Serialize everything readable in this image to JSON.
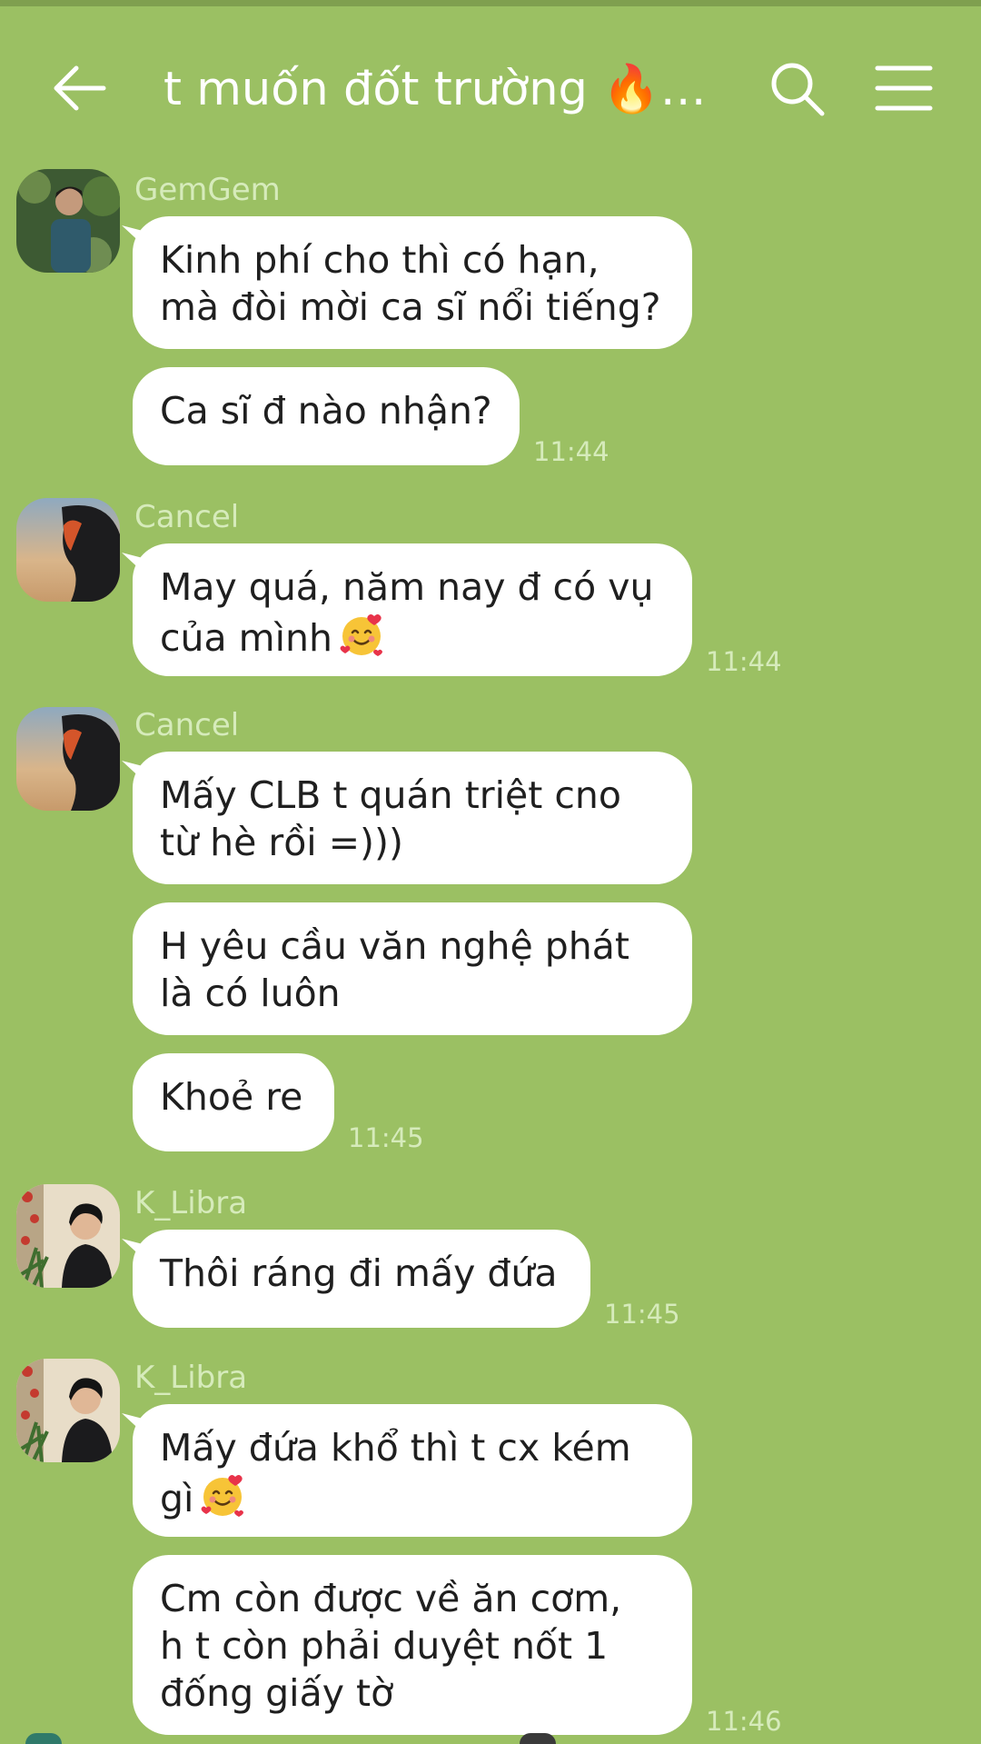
{
  "header": {
    "title": "t muốn đốt trường 🔥…"
  },
  "messages": {
    "m1": {
      "sender": "GemGem",
      "text": "Kinh phí cho thì có hạn,\nmà đòi mời ca sĩ nổi tiếng?"
    },
    "m2": {
      "text": "Ca sĩ đ nào nhận?",
      "time": "11:44"
    },
    "m3": {
      "sender": "Cancel",
      "text": "May quá, năm nay đ có vụ\ncủa mình",
      "time": "11:44"
    },
    "m4": {
      "sender": "Cancel",
      "text": "Mấy CLB t quán triệt cno\ntừ hè rồi =)))"
    },
    "m5": {
      "text": "H yêu cầu văn nghệ phát\nlà có luôn"
    },
    "m6": {
      "text": "Khoẻ re",
      "time": "11:45"
    },
    "m7": {
      "sender": "K_Libra",
      "text": "Thôi ráng đi mấy đứa",
      "time": "11:45"
    },
    "m8": {
      "sender": "K_Libra",
      "text": "Mấy đứa khổ thì t cx kém\ngì"
    },
    "m9": {
      "text": "Cm còn được về ăn cơm,\nh t còn phải duyệt nốt 1\nđống giấy tờ",
      "time": "11:46"
    }
  },
  "icons": {
    "back": "arrow-left-icon",
    "search": "search-icon",
    "menu": "hamburger-menu-icon",
    "emoji": "smiling-face-with-hearts-emoji"
  },
  "colors": {
    "background": "#9bc063",
    "bubble": "#ffffff",
    "meta_text": "#d6ebbb"
  }
}
